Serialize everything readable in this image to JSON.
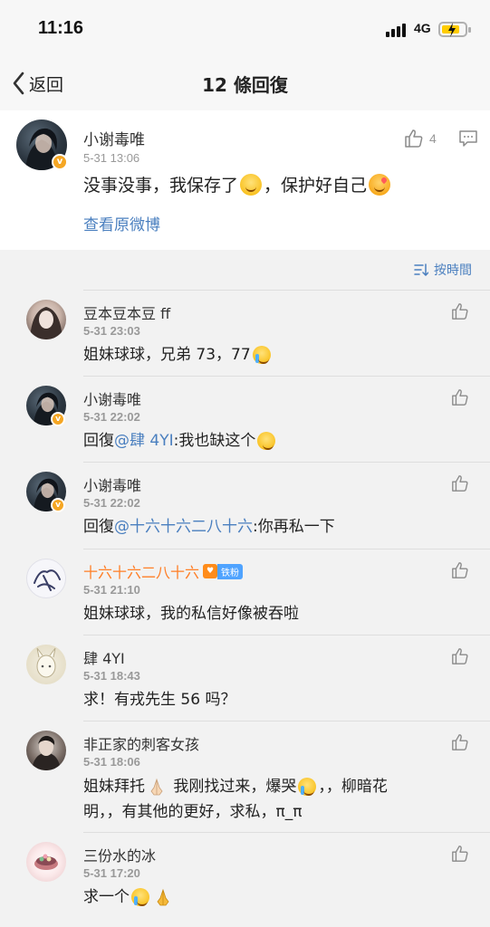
{
  "status_bar": {
    "time": "11:16",
    "network": "4G"
  },
  "nav": {
    "back_label": "返回",
    "title": "12 條回復"
  },
  "original": {
    "author": "小谢毒唯",
    "time": "5-31 13:06",
    "text_part1": "没事没事，我保存了",
    "text_part2": "，保护好自己",
    "like_count": "4",
    "view_original": "查看原微博"
  },
  "sort": {
    "label": "按時間"
  },
  "replies": [
    {
      "name": "豆本豆本豆 ff",
      "time": "5-31 23:03",
      "text": "姐妹球球，兄弟 73，77"
    },
    {
      "name": "小谢毒唯",
      "time": "5-31 22:02",
      "prefix": "回復",
      "mention": "@肆 4YI",
      "text": ":我也缺这个"
    },
    {
      "name": "小谢毒唯",
      "time": "5-31 22:02",
      "prefix": "回復",
      "mention": "@十六十六二八十六",
      "text": ":你再私一下"
    },
    {
      "name": "十六十六二八十六",
      "badge": "铁粉",
      "time": "5-31 21:10",
      "text": "姐妹球球，我的私信好像被吞啦"
    },
    {
      "name": "肆 4YI",
      "time": "5-31 18:43",
      "text": "求！有戎先生 56 吗？"
    },
    {
      "name": "非正家的刺客女孩",
      "time": "5-31 18:06",
      "text_part1": "姐妹拜托",
      "text_part2": " 我刚找过来，爆哭",
      "text_part3": "，，柳暗花明，，有其他的更好，求私，π_π"
    },
    {
      "name": "三份水的冰",
      "time": "5-31 17:20",
      "text": "求一个"
    }
  ]
}
